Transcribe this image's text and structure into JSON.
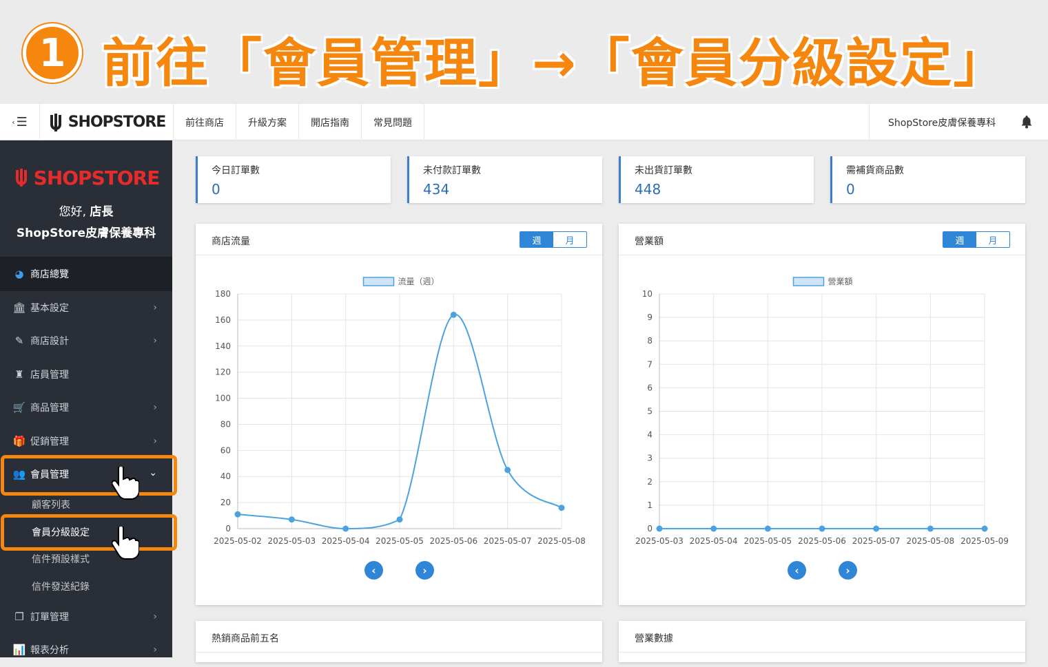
{
  "banner": {
    "step": "1",
    "title": "前往「會員管理」→「會員分級設定」"
  },
  "topbar": {
    "toggle_icon": "☰",
    "brand": "SHOPSTORE",
    "links": [
      "前往商店",
      "升級方案",
      "開店指南",
      "常見問題"
    ],
    "store_name": "ShopStore皮膚保養專科"
  },
  "sidebar": {
    "logo": "SHOPSTORE",
    "greeting_prefix": "您好, ",
    "greeting_role": "店長",
    "store_name": "ShopStore皮膚保養專科",
    "items": [
      {
        "label": "商店總覽",
        "icon": "dashboard-icon"
      },
      {
        "label": "基本設定",
        "icon": "bank-icon"
      },
      {
        "label": "商店設計",
        "icon": "magic-wand-icon"
      },
      {
        "label": "店員管理",
        "icon": "user-secret-icon"
      },
      {
        "label": "商品管理",
        "icon": "cart-icon"
      },
      {
        "label": "促銷管理",
        "icon": "gift-icon"
      },
      {
        "label": "會員管理",
        "icon": "users-icon"
      },
      {
        "label": "訂單管理",
        "icon": "copy-icon"
      },
      {
        "label": "報表分析",
        "icon": "bar-chart-icon"
      }
    ],
    "member_sub": [
      "顧客列表",
      "會員分級設定",
      "信件預設樣式",
      "信件發送紀錄"
    ]
  },
  "stats": [
    {
      "label": "今日訂單數",
      "value": "0"
    },
    {
      "label": "未付款訂單數",
      "value": "434"
    },
    {
      "label": "未出貨訂單數",
      "value": "448"
    },
    {
      "label": "需補貨商品數",
      "value": "0"
    }
  ],
  "traffic_panel": {
    "title": "商店流量",
    "week": "週",
    "month": "月"
  },
  "revenue_panel": {
    "title": "營業額",
    "week": "週",
    "month": "月"
  },
  "bottom_panels": {
    "left_title": "熱銷商品前五名",
    "right_title": "營業數據"
  },
  "colors": {
    "accent": "#2f86d6",
    "highlight": "#f5870f",
    "line": "#4aa3df"
  },
  "chart_data": [
    {
      "type": "line",
      "legend": "流量（週）",
      "x": [
        "2025-05-02",
        "2025-05-03",
        "2025-05-04",
        "2025-05-05",
        "2025-05-06",
        "2025-05-07",
        "2025-05-08"
      ],
      "values": [
        11,
        7,
        0,
        7,
        164,
        45,
        16
      ],
      "ylim": [
        0,
        180
      ],
      "yticks": [
        0,
        20,
        40,
        60,
        80,
        100,
        120,
        140,
        160,
        180
      ],
      "grid": true,
      "legend_position": "top"
    },
    {
      "type": "line",
      "legend": "營業額",
      "x": [
        "2025-05-03",
        "2025-05-04",
        "2025-05-05",
        "2025-05-06",
        "2025-05-07",
        "2025-05-08",
        "2025-05-09"
      ],
      "values": [
        0,
        0,
        0,
        0,
        0,
        0,
        0
      ],
      "ylim": [
        0,
        10
      ],
      "yticks": [
        0,
        1,
        2,
        3,
        4,
        5,
        6,
        7,
        8,
        9,
        10
      ],
      "grid": true,
      "legend_position": "top"
    }
  ]
}
